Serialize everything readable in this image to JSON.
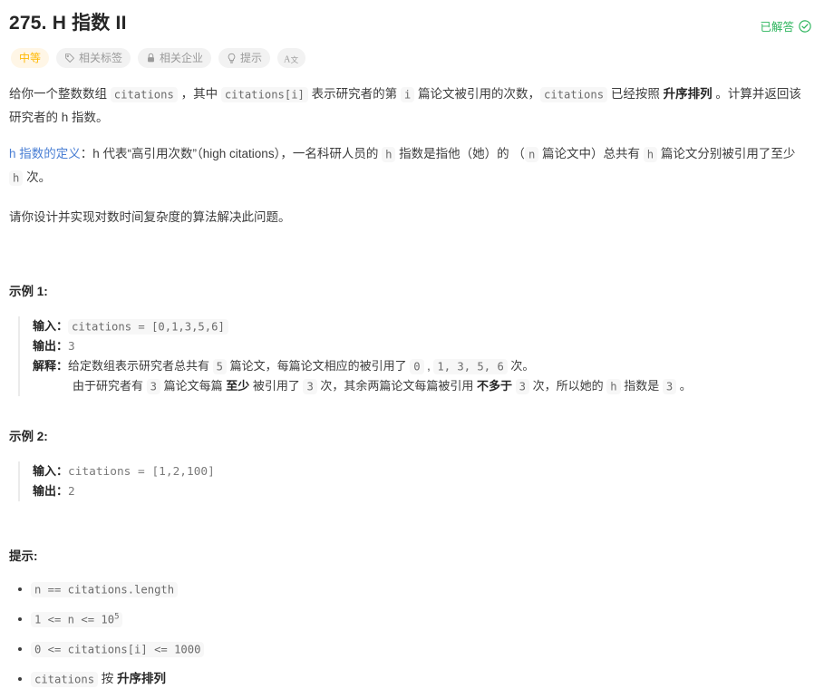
{
  "header": {
    "title": "275. H 指数 II",
    "status_label": "已解答",
    "status_color": "#2db55d",
    "status_icon": "check-circle-icon"
  },
  "pills": [
    {
      "label": "中等",
      "icon": null,
      "kind": "difficulty",
      "color": "#ffb800"
    },
    {
      "label": "相关标签",
      "icon": "tag-icon",
      "kind": "normal"
    },
    {
      "label": "相关企业",
      "icon": "lock-icon",
      "kind": "normal"
    },
    {
      "label": "提示",
      "icon": "lightbulb-icon",
      "kind": "normal"
    },
    {
      "label": "",
      "icon": "translate-icon",
      "kind": "icon-only"
    }
  ],
  "description": {
    "p1": {
      "t1": "给你一个整数数组 ",
      "c1": "citations",
      "t2": " ，其中 ",
      "c2": "citations[i]",
      "t3": " 表示研究者的第 ",
      "c3": "i",
      "t4": " 篇论文被引用的次数，",
      "c4": "citations",
      "t5": " 已经按照 ",
      "b1": "升序排列",
      "t6": " 。计算并返回该研究者的 h 指数。"
    },
    "p2": {
      "link": "h 指数的定义",
      "t1": "：h 代表“高引用次数”（high citations），一名科研人员的 ",
      "c1": "h",
      "t2": " 指数是指他（她）的 （",
      "c2": "n",
      "t3": " 篇论文中）总共有 ",
      "c3": "h",
      "t4": " 篇论文分别被引用了至少 ",
      "c4": "h",
      "t5": " 次。"
    },
    "p3": "请你设计并实现对数时间复杂度的算法解决此问题。"
  },
  "examples": [
    {
      "title": "示例 1:",
      "input_label": "输入：",
      "input_code": "citations = [0,1,3,5,6]",
      "output_label": "输出：",
      "output_value": "3",
      "explain_label": "解释：",
      "explain_l1_t1": "给定数组表示研究者总共有 ",
      "explain_l1_c1": "5",
      "explain_l1_t2": " 篇论文，每篇论文相应的被引用了 ",
      "explain_l1_c2": "0",
      "explain_l1_t3": " , ",
      "explain_l1_c3": "1, 3, 5, 6",
      "explain_l1_t4": " 次。",
      "explain_l2_t1": "由于研究者有 ",
      "explain_l2_c1": "3",
      "explain_l2_t2": " 篇论文每篇 ",
      "explain_l2_b1": "至少",
      "explain_l2_t3": " 被引用了 ",
      "explain_l2_c2": "3",
      "explain_l2_t4": " 次，其余两篇论文每篇被引用 ",
      "explain_l2_b2": "不多于",
      "explain_l2_t5": " ",
      "explain_l2_c3": "3",
      "explain_l2_t6": " 次，所以她的 ",
      "explain_l2_c4": "h",
      "explain_l2_t7": " 指数是 ",
      "explain_l2_c5": "3",
      "explain_l2_t8": " 。"
    },
    {
      "title": "示例 2:",
      "input_label": "输入：",
      "input_code": "citations = [1,2,100]",
      "output_label": "输出：",
      "output_value": "2"
    }
  ],
  "hints": {
    "title": "提示:",
    "items": [
      {
        "code_pre": "n == citations.length",
        "sup": null,
        "code_post": null,
        "suffix_text": null,
        "suffix_bold": null
      },
      {
        "code_pre": "1 <= n <= 10",
        "sup": "5",
        "code_post": null,
        "suffix_text": null,
        "suffix_bold": null
      },
      {
        "code_pre": "0 <= citations[i] <= 1000",
        "sup": null,
        "code_post": null,
        "suffix_text": null,
        "suffix_bold": null
      },
      {
        "code_pre": "citations",
        "sup": null,
        "code_post": null,
        "suffix_text": " 按 ",
        "suffix_bold": "升序排列"
      }
    ]
  }
}
